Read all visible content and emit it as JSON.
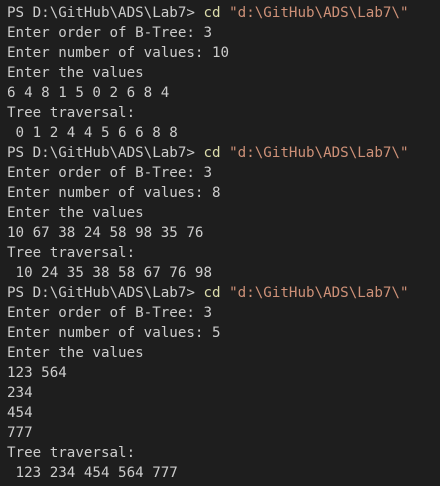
{
  "terminal": {
    "runs": [
      {
        "prompt": "PS D:\\GitHub\\ADS\\Lab7> ",
        "command": "cd",
        "argument": "\"d:\\GitHub\\ADS\\Lab7\\\"",
        "output": [
          "Enter order of B-Tree: 3",
          "Enter number of values: 10",
          "Enter the values",
          "6 4 8 1 5 0 2 6 8 4",
          "Tree traversal:",
          " 0 1 2 4 4 5 6 6 8 8"
        ]
      },
      {
        "prompt": "PS D:\\GitHub\\ADS\\Lab7> ",
        "command": "cd",
        "argument": "\"d:\\GitHub\\ADS\\Lab7\\\"",
        "output": [
          "Enter order of B-Tree: 3",
          "Enter number of values: 8",
          "Enter the values",
          "10 67 38 24 58 98 35 76",
          "Tree traversal:",
          " 10 24 35 38 58 67 76 98"
        ]
      },
      {
        "prompt": "PS D:\\GitHub\\ADS\\Lab7> ",
        "command": "cd",
        "argument": "\"d:\\GitHub\\ADS\\Lab7\\\"",
        "output": [
          "Enter order of B-Tree: 3",
          "Enter number of values: 5",
          "Enter the values",
          "123 564",
          "234",
          "454",
          "777",
          "Tree traversal:",
          " 123 234 454 564 777"
        ]
      }
    ],
    "colors": {
      "background": "#1e1e1e",
      "text": "#cccccc",
      "command": "#dcdcaa",
      "string": "#ce9178"
    }
  }
}
